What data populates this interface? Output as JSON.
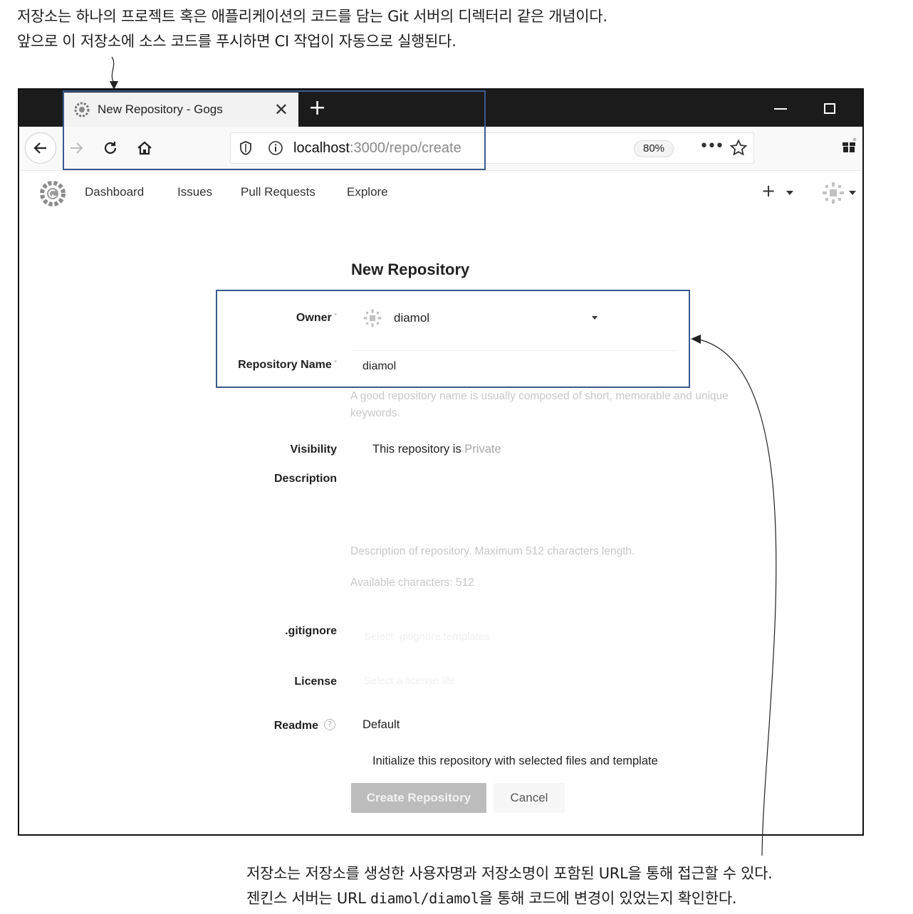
{
  "annotations": {
    "top_line1": "저장소는 하나의 프로젝트 혹은 애플리케이션의 코드를 담는 Git 서버의 디렉터리 같은 개념이다.",
    "top_line2": "앞으로 이 저장소에 소스 코드를 푸시하면 CI 작업이 자동으로 실행된다.",
    "bottom_line1": "저장소는 저장소를 생성한 사용자명과 저장소명이 포함된 URL을 통해 접근할 수 있다.",
    "bottom_line2_a": "젠킨스 서버는 URL ",
    "bottom_line2_code": "diamol/diamol",
    "bottom_line2_b": "을 통해 코드에 변경이 있었는지 확인한다."
  },
  "browser": {
    "tab_title": "New Repository - Gogs",
    "url_host": "localhost",
    "url_path": ":3000/repo/create",
    "zoom": "80%"
  },
  "app": {
    "nav": {
      "dashboard": "Dashboard",
      "issues": "Issues",
      "pull_requests": "Pull Requests",
      "explore": "Explore"
    }
  },
  "form": {
    "title": "New Repository",
    "owner_label": "Owner",
    "owner_value": "diamol",
    "repo_name_label": "Repository Name",
    "repo_name_value": "diamol",
    "repo_name_help": "A good repository name is usually composed of short, memorable and unique keywords.",
    "visibility_label": "Visibility",
    "visibility_text": "This repository is ",
    "visibility_value": "Private",
    "description_label": "Description",
    "description_help": "Description of repository. Maximum 512 characters length.",
    "available_chars": "Available characters: 512",
    "gitignore_label": ".gitignore",
    "gitignore_placeholder": "Select .gitignore templates",
    "license_label": "License",
    "license_placeholder": "Select a license file",
    "readme_label": "Readme",
    "readme_value": "Default",
    "initialize_text": "Initialize this repository with selected files and template",
    "create_button": "Create Repository",
    "cancel_button": "Cancel"
  }
}
